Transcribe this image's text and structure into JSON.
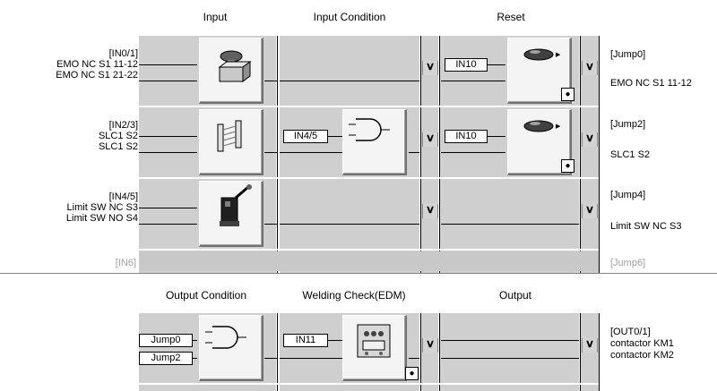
{
  "upper": {
    "headers": {
      "input": "Input",
      "input_condition": "Input Condition",
      "reset": "Reset"
    },
    "rows": [
      {
        "inputs_id": "[IN0/1]",
        "input_line1": "EMO NC S1 11-12",
        "input_line2": "EMO NC S1 21-22",
        "input_icon": "emergency-stop-icon",
        "condition_tag": "",
        "reset_tag": "IN10",
        "jump_id": "[Jump0]",
        "jump_label": "EMO NC S1 11-12"
      },
      {
        "inputs_id": "[IN2/3]",
        "input_line1": "SLC1 S2",
        "input_line2": "SLC1 S2",
        "input_icon": "light-curtain-icon",
        "condition_tag": "IN4/5",
        "reset_tag": "IN10",
        "jump_id": "[Jump2]",
        "jump_label": "SLC1 S2"
      },
      {
        "inputs_id": "[IN4/5]",
        "input_line1": "Limit SW NC S3",
        "input_line2": "Limit SW NO S4",
        "input_icon": "limit-switch-icon",
        "condition_tag": "",
        "reset_tag": "",
        "jump_id": "[Jump4]",
        "jump_label": "Limit SW NC S3"
      }
    ],
    "ghost_row": {
      "inputs_id": "[IN6]",
      "jump_id": "[Jump6]"
    }
  },
  "lower": {
    "headers": {
      "output_condition": "Output Condition",
      "welding_check": "Welding Check(EDM)",
      "output": "Output"
    },
    "condition_tags": [
      "Jump0",
      "Jump2"
    ],
    "edm_tag": "IN11",
    "output_id": "[OUT0/1]",
    "output_line1": "contactor KM1",
    "output_line2": "contactor KM2"
  },
  "icons": {
    "and_gate": "and-gate-icon",
    "push_button": "reset-button-icon",
    "contactor": "contactor-icon",
    "chevron": "chevron-down-icon"
  }
}
